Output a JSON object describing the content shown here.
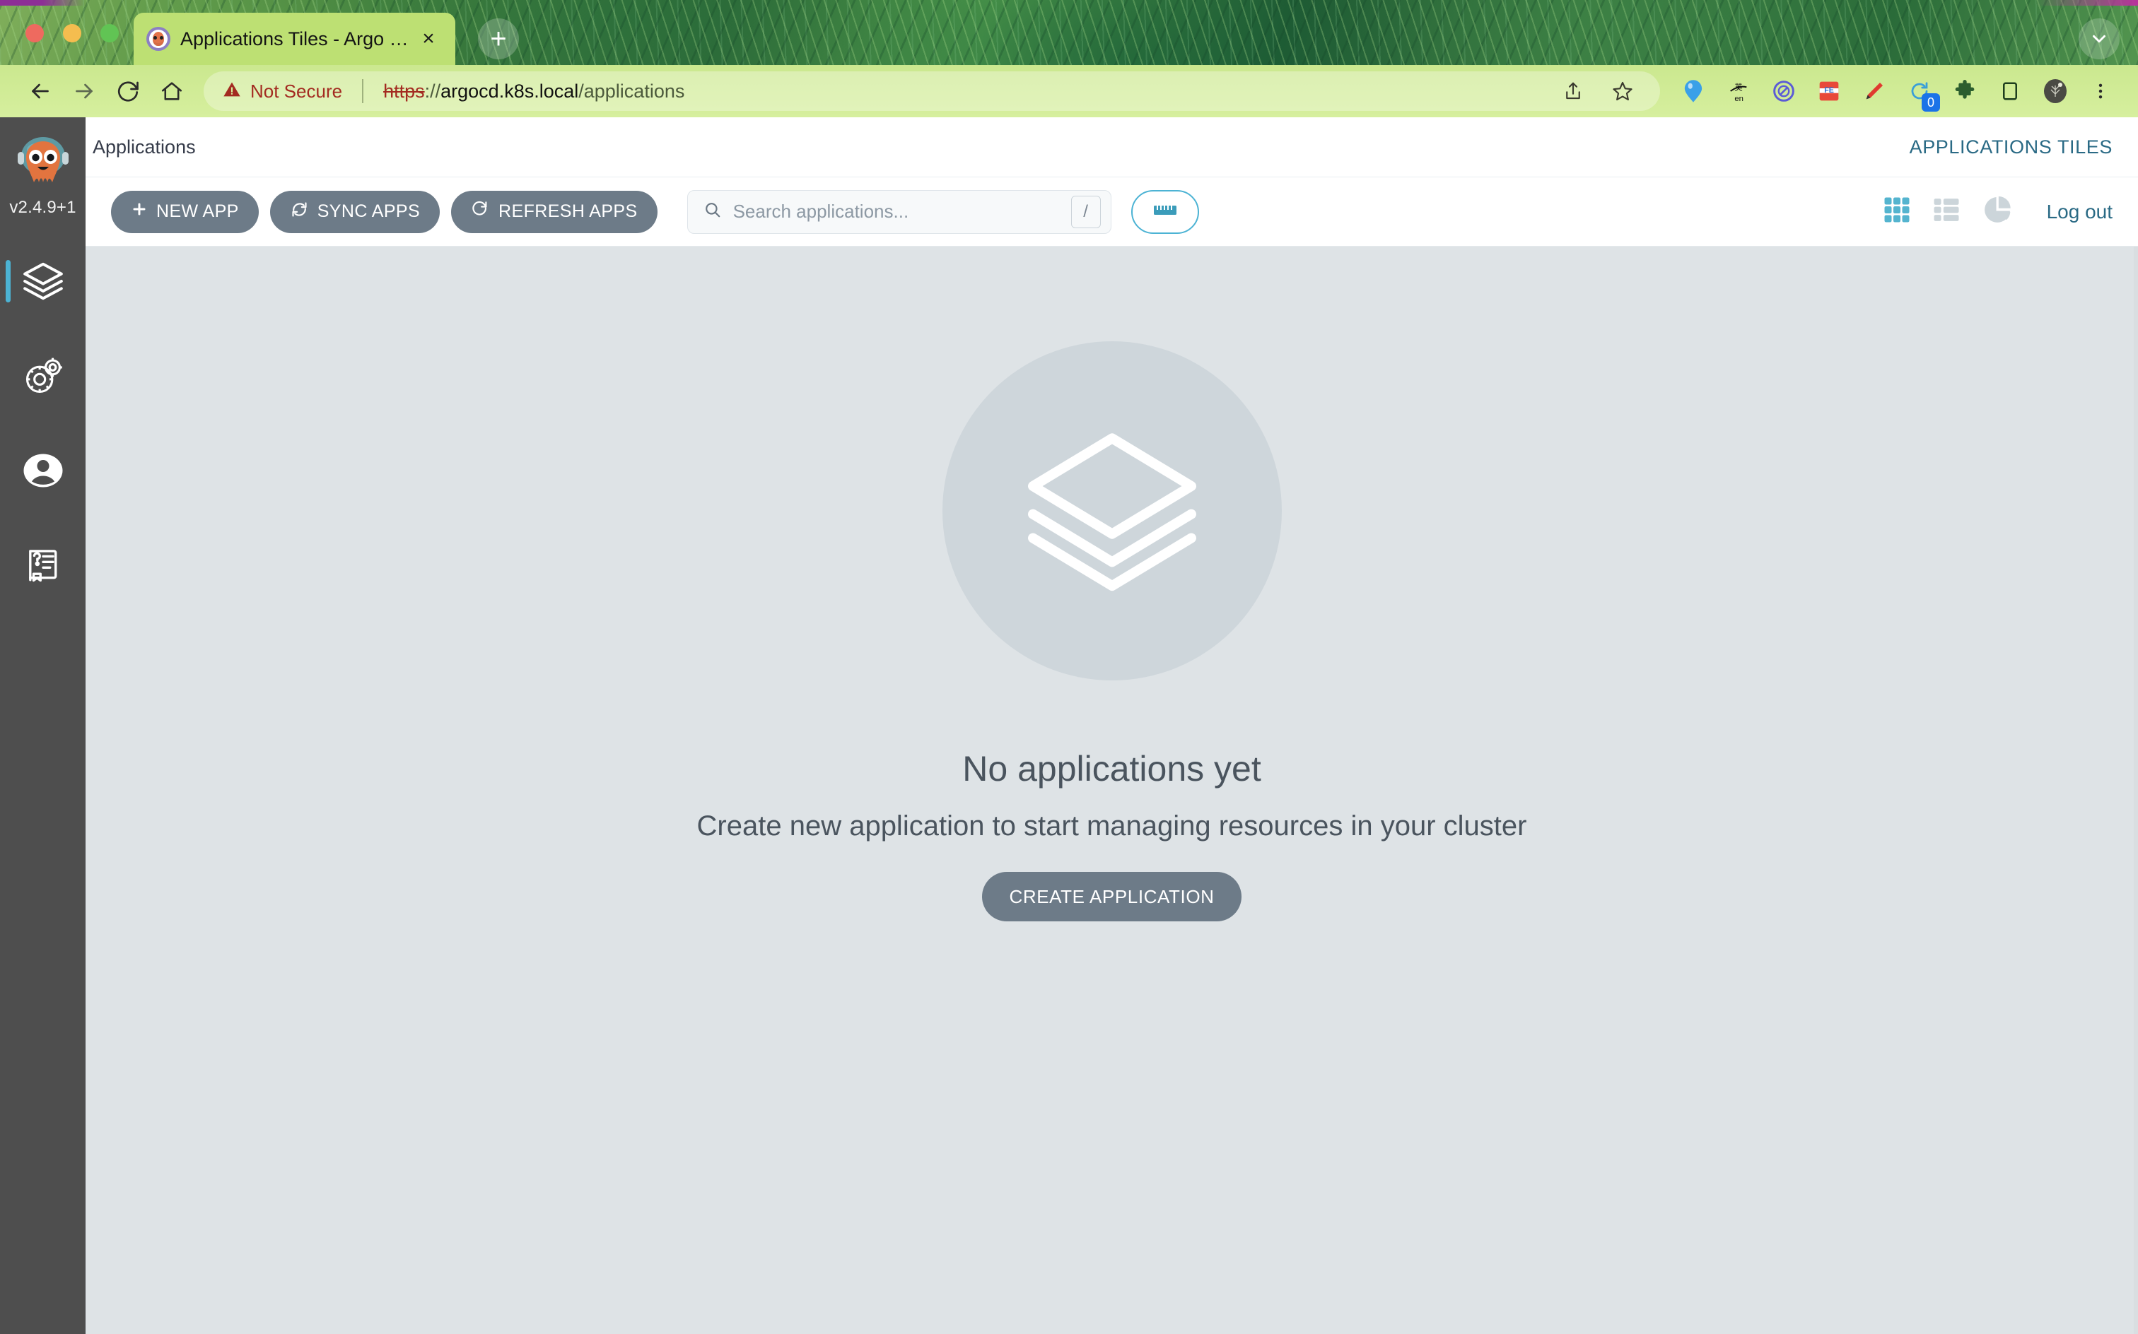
{
  "browser": {
    "window_controls": [
      "close",
      "minimize",
      "maximize"
    ],
    "tab": {
      "title": "Applications Tiles - Argo CD",
      "favicon": "argocd-octopus-favicon",
      "close_label": "×"
    },
    "new_tab_label": "+",
    "tab_search_icon": "chevron-down-icon",
    "nav": {
      "back_icon": "arrow-left-icon",
      "forward_icon": "arrow-right-icon",
      "reload_icon": "reload-icon",
      "home_icon": "home-icon"
    },
    "omnibox": {
      "security_label": "Not Secure",
      "security_icon": "warning-triangle-icon",
      "url_scheme": "https",
      "url_scheme_suffix": "://",
      "url_host": "argocd.k8s.local",
      "url_path": "/applications"
    },
    "toolbar_icons": [
      {
        "name": "share-icon",
        "glyph": "⤴"
      },
      {
        "name": "bookmark-star-icon",
        "glyph": "☆"
      },
      {
        "name": "extension-balloon-icon",
        "glyph": "▼"
      },
      {
        "name": "translate-extension-icon",
        "glyph": "英"
      },
      {
        "name": "adblock-extension-icon",
        "glyph": "⊘"
      },
      {
        "name": "feedly-extension-icon",
        "glyph": "FE"
      },
      {
        "name": "marker-extension-icon",
        "glyph": "╱"
      },
      {
        "name": "tab-reload-extension-icon",
        "glyph": "↻",
        "badge": "0"
      },
      {
        "name": "extensions-puzzle-icon",
        "glyph": "❖"
      },
      {
        "name": "side-panel-icon",
        "glyph": "▭"
      },
      {
        "name": "profile-avatar-icon",
        "glyph": "●"
      },
      {
        "name": "chrome-menu-icon",
        "glyph": "⋮"
      }
    ]
  },
  "sidebar": {
    "logo_name": "argo-cd-octopus-logo",
    "version": "v2.4.9+1",
    "items": [
      {
        "name": "applications",
        "icon": "layers-icon",
        "active": true
      },
      {
        "name": "settings",
        "icon": "gears-icon",
        "active": false
      },
      {
        "name": "user-info",
        "icon": "user-circle-icon",
        "active": false
      },
      {
        "name": "documentation",
        "icon": "help-book-icon",
        "active": false
      }
    ]
  },
  "header": {
    "title": "Applications",
    "right_label": "APPLICATIONS TILES"
  },
  "toolbar": {
    "new_app_label": "NEW APP",
    "new_app_icon": "plus-icon",
    "sync_apps_label": "SYNC APPS",
    "sync_apps_icon": "sync-icon",
    "refresh_apps_label": "REFRESH APPS",
    "refresh_apps_icon": "refresh-icon",
    "search": {
      "placeholder": "Search applications...",
      "value": "",
      "icon": "search-icon",
      "shortcut_key": "/"
    },
    "filter_toggle_icon": "filter-ruler-icon",
    "view_tiles_icon": "grid-tiles-icon",
    "view_list_icon": "list-view-icon",
    "view_summary_icon": "pie-chart-icon",
    "logout_label": "Log out"
  },
  "empty_state": {
    "icon": "layers-stack-icon",
    "title": "No applications yet",
    "subtitle": "Create new application to start managing resources in your cluster",
    "cta_label": "CREATE APPLICATION"
  },
  "colors": {
    "accent_teal": "#4cb3d4",
    "link_blue": "#2a6a85",
    "button_gray": "#6d7b88",
    "page_bg": "#dee3e6",
    "sidebar_bg": "#4e4e4e",
    "not_secure_red": "#a32b21",
    "tab_green": "#bde073"
  }
}
